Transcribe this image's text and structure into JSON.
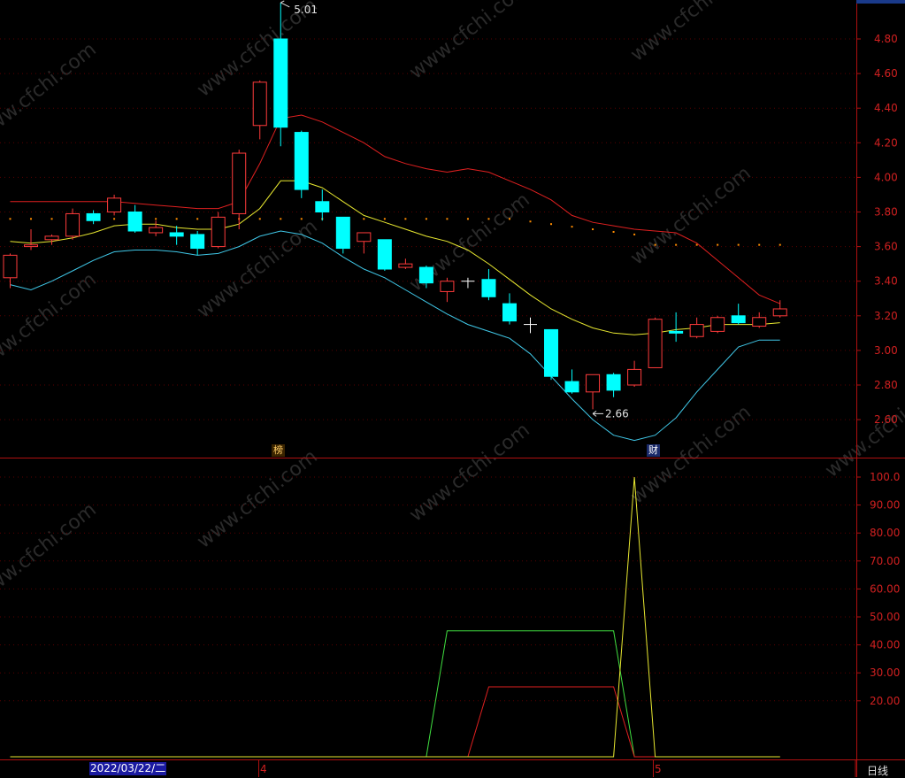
{
  "chart_data": [
    {
      "type": "candlestick",
      "ylim": [
        2.46,
        5.04
      ],
      "y_ticks": [
        "4.80",
        "4.60",
        "4.40",
        "4.20",
        "4.00",
        "3.80",
        "3.60",
        "3.40",
        "3.20",
        "3.00",
        "2.80",
        "2.60"
      ],
      "high_label": "5.01",
      "low_label": "2.66",
      "candles": [
        {
          "o": 3.42,
          "h": 3.56,
          "l": 3.36,
          "c": 3.55
        },
        {
          "o": 3.6,
          "h": 3.7,
          "l": 3.58,
          "c": 3.61
        },
        {
          "o": 3.64,
          "h": 3.67,
          "l": 3.61,
          "c": 3.66
        },
        {
          "o": 3.66,
          "h": 3.82,
          "l": 3.64,
          "c": 3.79
        },
        {
          "o": 3.79,
          "h": 3.81,
          "l": 3.73,
          "c": 3.75
        },
        {
          "o": 3.8,
          "h": 3.9,
          "l": 3.78,
          "c": 3.88
        },
        {
          "o": 3.8,
          "h": 3.84,
          "l": 3.68,
          "c": 3.69
        },
        {
          "o": 3.68,
          "h": 3.75,
          "l": 3.66,
          "c": 3.71
        },
        {
          "o": 3.68,
          "h": 3.72,
          "l": 3.61,
          "c": 3.66
        },
        {
          "o": 3.67,
          "h": 3.69,
          "l": 3.55,
          "c": 3.59
        },
        {
          "o": 3.6,
          "h": 3.8,
          "l": 3.59,
          "c": 3.77
        },
        {
          "o": 3.79,
          "h": 4.16,
          "l": 3.7,
          "c": 4.14
        },
        {
          "o": 4.3,
          "h": 4.56,
          "l": 4.22,
          "c": 4.55
        },
        {
          "o": 4.8,
          "h": 5.01,
          "l": 4.18,
          "c": 4.29
        },
        {
          "o": 4.26,
          "h": 4.27,
          "l": 3.88,
          "c": 3.93
        },
        {
          "o": 3.86,
          "h": 3.93,
          "l": 3.75,
          "c": 3.8
        },
        {
          "o": 3.77,
          "h": 3.77,
          "l": 3.56,
          "c": 3.59
        },
        {
          "o": 3.63,
          "h": 3.68,
          "l": 3.56,
          "c": 3.68
        },
        {
          "o": 3.64,
          "h": 3.64,
          "l": 3.46,
          "c": 3.47
        },
        {
          "o": 3.48,
          "h": 3.53,
          "l": 3.47,
          "c": 3.5
        },
        {
          "o": 3.48,
          "h": 3.49,
          "l": 3.36,
          "c": 3.39
        },
        {
          "o": 3.34,
          "h": 3.42,
          "l": 3.28,
          "c": 3.4
        },
        {
          "o": 3.4,
          "h": 3.42,
          "l": 3.36,
          "c": 3.4
        },
        {
          "o": 3.41,
          "h": 3.47,
          "l": 3.29,
          "c": 3.31
        },
        {
          "o": 3.27,
          "h": 3.33,
          "l": 3.15,
          "c": 3.17
        },
        {
          "o": 3.15,
          "h": 3.19,
          "l": 3.1,
          "c": 3.15
        },
        {
          "o": 3.12,
          "h": 3.12,
          "l": 2.83,
          "c": 2.85
        },
        {
          "o": 2.82,
          "h": 2.89,
          "l": 2.75,
          "c": 2.76
        },
        {
          "o": 2.76,
          "h": 2.86,
          "l": 2.66,
          "c": 2.86
        },
        {
          "o": 2.86,
          "h": 2.87,
          "l": 2.73,
          "c": 2.77
        },
        {
          "o": 2.8,
          "h": 2.94,
          "l": 2.79,
          "c": 2.89
        },
        {
          "o": 2.9,
          "h": 3.19,
          "l": 2.9,
          "c": 3.18
        },
        {
          "o": 3.11,
          "h": 3.22,
          "l": 3.05,
          "c": 3.1
        },
        {
          "o": 3.08,
          "h": 3.19,
          "l": 3.07,
          "c": 3.15
        },
        {
          "o": 3.11,
          "h": 3.2,
          "l": 3.1,
          "c": 3.19
        },
        {
          "o": 3.2,
          "h": 3.27,
          "l": 3.15,
          "c": 3.16
        },
        {
          "o": 3.14,
          "h": 3.22,
          "l": 3.13,
          "c": 3.19
        },
        {
          "o": 3.2,
          "h": 3.29,
          "l": 3.19,
          "c": 3.24
        }
      ],
      "series": [
        {
          "color": "#e02020",
          "values": [
            3.86,
            3.86,
            3.86,
            3.86,
            3.86,
            3.86,
            3.85,
            3.84,
            3.83,
            3.82,
            3.82,
            3.86,
            4.08,
            4.34,
            4.36,
            4.32,
            4.26,
            4.2,
            4.12,
            4.08,
            4.05,
            4.03,
            4.05,
            4.03,
            3.98,
            3.93,
            3.87,
            3.78,
            3.74,
            3.72,
            3.7,
            3.69,
            3.68,
            3.62,
            3.52,
            3.42,
            3.32,
            3.27
          ]
        },
        {
          "color": "#e8e830",
          "values": [
            3.63,
            3.62,
            3.63,
            3.65,
            3.68,
            3.72,
            3.73,
            3.73,
            3.71,
            3.7,
            3.7,
            3.73,
            3.82,
            3.98,
            3.98,
            3.94,
            3.86,
            3.78,
            3.74,
            3.7,
            3.66,
            3.63,
            3.58,
            3.5,
            3.41,
            3.32,
            3.24,
            3.18,
            3.13,
            3.1,
            3.09,
            3.1,
            3.12,
            3.13,
            3.15,
            3.15,
            3.15,
            3.16
          ]
        },
        {
          "color": "#40c8e8",
          "values": [
            3.38,
            3.35,
            3.4,
            3.46,
            3.52,
            3.57,
            3.58,
            3.58,
            3.57,
            3.55,
            3.56,
            3.6,
            3.66,
            3.69,
            3.67,
            3.62,
            3.54,
            3.47,
            3.42,
            3.35,
            3.28,
            3.21,
            3.15,
            3.11,
            3.07,
            2.98,
            2.85,
            2.72,
            2.6,
            2.51,
            2.48,
            2.51,
            2.61,
            2.76,
            2.89,
            3.02,
            3.06,
            3.06
          ]
        }
      ],
      "dotted_level": 3.76,
      "dotted_level_2": 3.61
    },
    {
      "type": "line",
      "ylim": [
        0,
        100
      ],
      "y_ticks": [
        "100.0",
        "90.00",
        "80.00",
        "70.00",
        "60.00",
        "50.00",
        "40.00",
        "30.00",
        "20.00"
      ],
      "series": [
        {
          "color": "#40e040",
          "points": [
            [
              0,
              0
            ],
            [
              20,
              0
            ],
            [
              21,
              45
            ],
            [
              29,
              45
            ],
            [
              30,
              0
            ],
            [
              37,
              0
            ]
          ]
        },
        {
          "color": "#e02020",
          "points": [
            [
              0,
              0
            ],
            [
              22,
              0
            ],
            [
              23,
              25
            ],
            [
              29,
              25
            ],
            [
              30,
              0
            ],
            [
              37,
              0
            ]
          ]
        },
        {
          "color": "#e8e830",
          "points": [
            [
              0,
              0
            ],
            [
              29,
              0
            ],
            [
              30,
              100
            ],
            [
              31,
              0
            ],
            [
              37,
              0
            ]
          ]
        }
      ]
    }
  ],
  "badges": {
    "bang": "榜",
    "cai": "财"
  },
  "footer": {
    "date": "2022/03/22/二",
    "month_0": "4",
    "month_1": "5",
    "period": "日线"
  },
  "watermark": "www.cfchi.com"
}
